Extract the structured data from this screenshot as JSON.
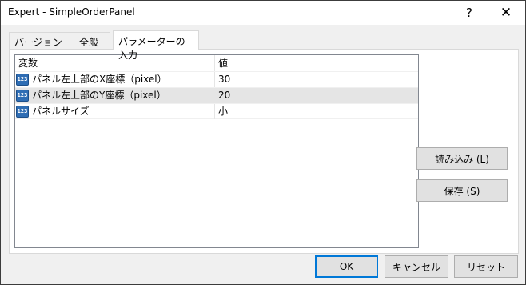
{
  "window": {
    "title": "Expert - SimpleOrderPanel",
    "help_label": "?",
    "close_label": "✕"
  },
  "tabs": [
    {
      "label": "バージョン情報"
    },
    {
      "label": "全般"
    },
    {
      "label": "パラメーターの入力",
      "active": true
    }
  ],
  "grid": {
    "headers": [
      "変数",
      "値"
    ],
    "rows": [
      {
        "icon": "param-number-icon",
        "icon_text": "123",
        "name": "パネル左上部のX座標（pixel）",
        "value": "30"
      },
      {
        "icon": "param-number-icon",
        "icon_text": "123",
        "name": "パネル左上部のY座標（pixel）",
        "value": "20",
        "selected": true
      },
      {
        "icon": "param-number-icon",
        "icon_text": "123",
        "name": "パネルサイズ",
        "value": "小"
      }
    ]
  },
  "side_buttons": {
    "load": "読み込み (L)",
    "save": "保存 (S)"
  },
  "footer": {
    "ok": "OK",
    "cancel": "キャンセル",
    "reset": "リセット"
  },
  "colors": {
    "accent": "#0078d7",
    "selected_row": "#e5e5e5",
    "icon_blue": "#2e6db4"
  }
}
